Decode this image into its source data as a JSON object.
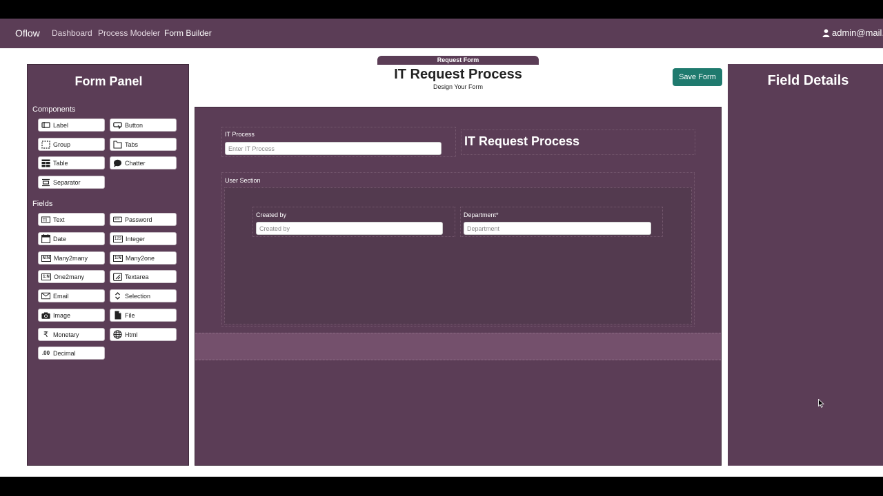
{
  "navbar": {
    "brand": "Oflow",
    "links": [
      {
        "label": "Dashboard"
      },
      {
        "label": "Process Modeler"
      },
      {
        "label": "Form Builder"
      }
    ],
    "user": "admin@mail."
  },
  "left_panel": {
    "title": "Form Panel",
    "components_label": "Components",
    "components": [
      {
        "label": "Label",
        "icon": "label-icon"
      },
      {
        "label": "Button",
        "icon": "button-icon"
      },
      {
        "label": "Group",
        "icon": "group-icon"
      },
      {
        "label": "Tabs",
        "icon": "tabs-icon"
      },
      {
        "label": "Table",
        "icon": "table-icon"
      },
      {
        "label": "Chatter",
        "icon": "chat-icon"
      },
      {
        "label": "Separator",
        "icon": "separator-icon"
      }
    ],
    "fields_label": "Fields",
    "fields": [
      {
        "label": "Text",
        "icon": "text-field-icon"
      },
      {
        "label": "Password",
        "icon": "password-icon"
      },
      {
        "label": "Date",
        "icon": "calendar-icon"
      },
      {
        "label": "Integer",
        "icon": "integer-icon",
        "glyph": "123"
      },
      {
        "label": "Many2many",
        "icon": "many2many-icon",
        "glyph": "N:N"
      },
      {
        "label": "Many2one",
        "icon": "many2one-icon",
        "glyph": "1:N"
      },
      {
        "label": "One2many",
        "icon": "one2many-icon",
        "glyph": "1:N"
      },
      {
        "label": "Textarea",
        "icon": "textarea-icon"
      },
      {
        "label": "Email",
        "icon": "email-icon"
      },
      {
        "label": "Selection",
        "icon": "selection-icon"
      },
      {
        "label": "Image",
        "icon": "camera-icon"
      },
      {
        "label": "File",
        "icon": "file-icon"
      },
      {
        "label": "Monetary",
        "icon": "rupee-icon",
        "glyph": "₹"
      },
      {
        "label": "Html",
        "icon": "globe-icon"
      },
      {
        "label": "Decimal",
        "icon": "decimal-icon",
        "glyph": ".00"
      }
    ]
  },
  "center": {
    "tab": "Request Form",
    "title": "IT Request Process",
    "subtitle": "Design Your Form",
    "save_label": "Save Form",
    "canvas": {
      "it_process": {
        "label": "IT Process",
        "placeholder": "Enter IT Process"
      },
      "heading": "IT Request Process",
      "user_section": {
        "label": "User Section",
        "created_by": {
          "label": "Created by",
          "placeholder": "Created by"
        },
        "department": {
          "label": "Department*",
          "placeholder": "Department"
        }
      }
    }
  },
  "right_panel": {
    "title": "Field Details"
  },
  "colors": {
    "panel": "#5b3d56",
    "accent": "#1f7a6e",
    "drop_zone": "#74506c"
  }
}
